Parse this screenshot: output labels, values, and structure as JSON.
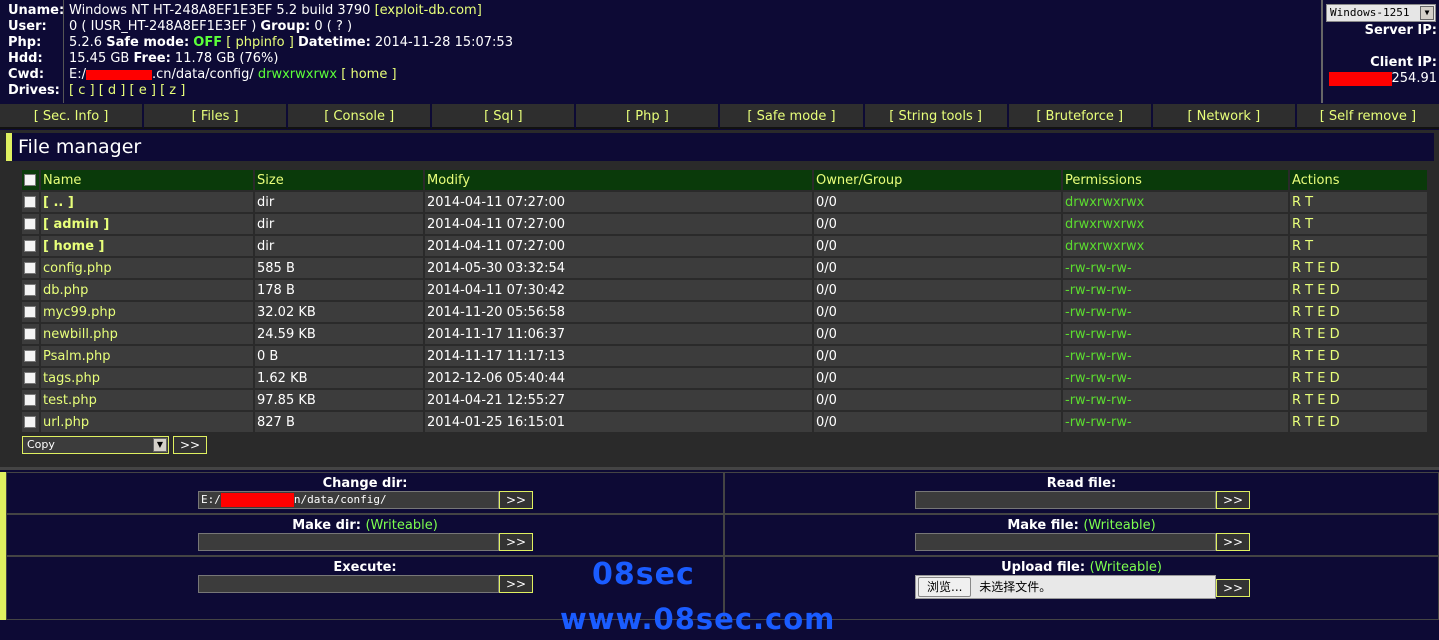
{
  "info": {
    "uname_key": "Uname:",
    "uname_val": "Windows NT HT-248A8EF1E3EF 5.2 build 3790",
    "exploit_link": "[exploit-db.com]",
    "user_key": "User:",
    "user_val": "0 ( IUSR_HT-248A8EF1E3EF )",
    "group_label": "Group:",
    "group_val": "0 ( ? )",
    "php_key": "Php:",
    "php_version": "5.2.6",
    "safe_mode_label": "Safe mode:",
    "safe_mode_val": "OFF",
    "phpinfo_link": "[ phpinfo ]",
    "datetime_label": "Datetime:",
    "datetime_val": "2014-11-28 15:07:53",
    "hdd_key": "Hdd:",
    "hdd_val": "15.45 GB",
    "free_label": "Free:",
    "free_val": "11.78 GB (76%)",
    "cwd_key": "Cwd:",
    "cwd_prefix": "E:/",
    "cwd_suffix": ".cn/data/config/",
    "cwd_perms": "drwxrwxrwx",
    "home_link": "[ home ]",
    "drives_key": "Drives:",
    "drives": [
      "[ c ]",
      "[ d ]",
      "[ e ]",
      "[ z ]"
    ],
    "charset": "Windows-1251",
    "server_ip_label": "Server IP:",
    "client_ip_label": "Client IP:",
    "client_ip_suffix": "254.91"
  },
  "menu": [
    "[ Sec. Info ]",
    "[ Files ]",
    "[ Console ]",
    "[ Sql ]",
    "[ Php ]",
    "[ Safe mode ]",
    "[ String tools ]",
    "[ Bruteforce ]",
    "[ Network ]",
    "[ Self remove ]"
  ],
  "file_manager": {
    "title": "File manager",
    "columns": [
      "Name",
      "Size",
      "Modify",
      "Owner/Group",
      "Permissions",
      "Actions"
    ],
    "rows": [
      {
        "name": "[ .. ]",
        "size": "dir",
        "modify": "2014-04-11 07:27:00",
        "owner": "0/0",
        "perms": "drwxrwxrwx",
        "actions": "R T"
      },
      {
        "name": "[ admin ]",
        "size": "dir",
        "modify": "2014-04-11 07:27:00",
        "owner": "0/0",
        "perms": "drwxrwxrwx",
        "actions": "R T"
      },
      {
        "name": "[ home ]",
        "size": "dir",
        "modify": "2014-04-11 07:27:00",
        "owner": "0/0",
        "perms": "drwxrwxrwx",
        "actions": "R T"
      },
      {
        "name": "config.php",
        "size": "585 B",
        "modify": "2014-05-30 03:32:54",
        "owner": "0/0",
        "perms": "-rw-rw-rw-",
        "actions": "R T E D"
      },
      {
        "name": "db.php",
        "size": "178 B",
        "modify": "2014-04-11 07:30:42",
        "owner": "0/0",
        "perms": "-rw-rw-rw-",
        "actions": "R T E D"
      },
      {
        "name": "myc99.php",
        "size": "32.02 KB",
        "modify": "2014-11-20 05:56:58",
        "owner": "0/0",
        "perms": "-rw-rw-rw-",
        "actions": "R T E D"
      },
      {
        "name": "newbill.php",
        "size": "24.59 KB",
        "modify": "2014-11-17 11:06:37",
        "owner": "0/0",
        "perms": "-rw-rw-rw-",
        "actions": "R T E D"
      },
      {
        "name": "Psalm.php",
        "size": "0 B",
        "modify": "2014-11-17 11:17:13",
        "owner": "0/0",
        "perms": "-rw-rw-rw-",
        "actions": "R T E D"
      },
      {
        "name": "tags.php",
        "size": "1.62 KB",
        "modify": "2012-12-06 05:40:44",
        "owner": "0/0",
        "perms": "-rw-rw-rw-",
        "actions": "R T E D"
      },
      {
        "name": "test.php",
        "size": "97.85 KB",
        "modify": "2014-04-21 12:55:27",
        "owner": "0/0",
        "perms": "-rw-rw-rw-",
        "actions": "R T E D"
      },
      {
        "name": "url.php",
        "size": "827 B",
        "modify": "2014-01-25 16:15:01",
        "owner": "0/0",
        "perms": "-rw-rw-rw-",
        "actions": "R T E D"
      }
    ],
    "bulk_action": "Copy",
    "go_label": ">>"
  },
  "tools": {
    "change_dir_label": "Change dir:",
    "change_dir_prefix": "E:/",
    "change_dir_suffix": "n/data/config/",
    "read_file_label": "Read file:",
    "make_dir_label": "Make dir:",
    "make_file_label": "Make file:",
    "writeable": "(Writeable)",
    "execute_label": "Execute:",
    "upload_file_label": "Upload file:",
    "browse_label": "浏览...",
    "no_file_text": "未选择文件。",
    "go_label": ">>"
  },
  "watermark": {
    "line1": "08sec",
    "line2": "www.08sec.com"
  },
  "colors": {
    "background": "#0d0a35",
    "accent_yellow": "#e8ff7a",
    "permission_green": "#5bdc2f",
    "table_header": "#0a3a0a",
    "redaction": "#ff0000"
  }
}
